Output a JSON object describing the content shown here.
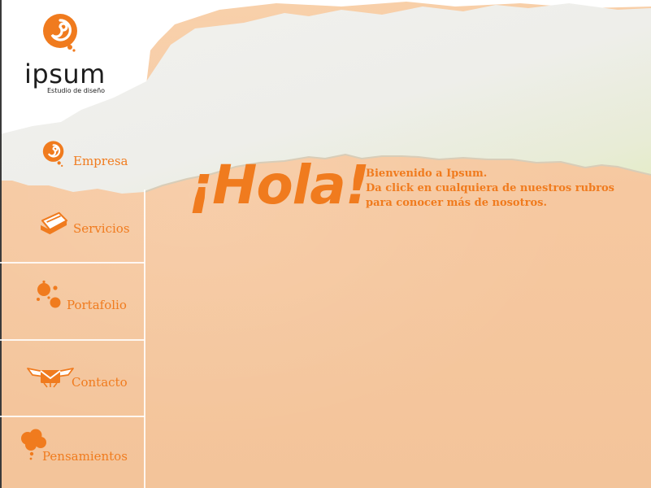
{
  "brand": {
    "name": "ipsum",
    "tagline": "Estudio de diseño",
    "logo_icon": "swirl-drop-icon",
    "accent_color": "#f07b1e"
  },
  "nav": {
    "items": [
      {
        "label": "Empresa",
        "icon": "swirl-drop-icon"
      },
      {
        "label": "Servicios",
        "icon": "folder-tag-icon"
      },
      {
        "label": "Portafolio",
        "icon": "paint-splash-icon"
      },
      {
        "label": "Contacto",
        "icon": "winged-envelope-icon"
      },
      {
        "label": "Pensamientos",
        "icon": "thought-cloud-icon"
      }
    ]
  },
  "main": {
    "heading": "¡Hola!",
    "lines": [
      "Bienvenido a Ipsum.",
      "Da click en cualquiera de nuestros rubros",
      "para conocer más de nosotros."
    ]
  }
}
